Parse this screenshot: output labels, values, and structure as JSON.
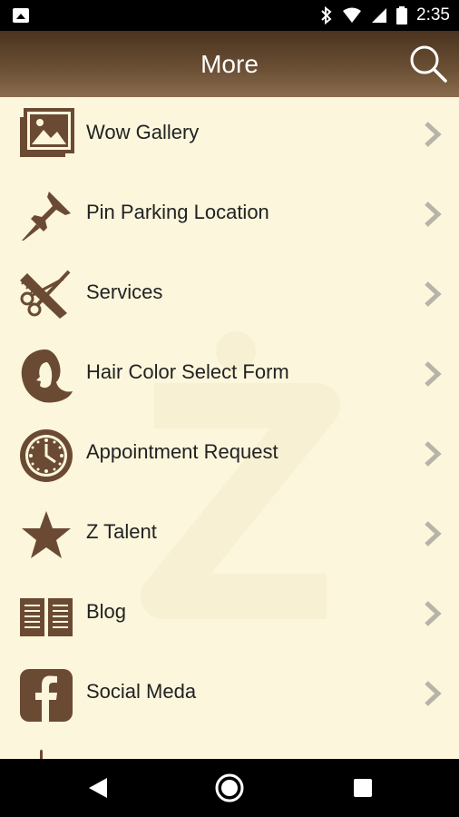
{
  "status_bar": {
    "time": "2:35"
  },
  "header": {
    "title": "More"
  },
  "menu": [
    {
      "label": "Wow Gallery",
      "icon": "gallery-icon"
    },
    {
      "label": "Pin Parking Location",
      "icon": "pushpin-icon"
    },
    {
      "label": "Services",
      "icon": "scissors-comb-icon"
    },
    {
      "label": "Hair Color Select Form",
      "icon": "woman-profile-icon"
    },
    {
      "label": "Appointment Request",
      "icon": "clock-icon"
    },
    {
      "label": "Z Talent",
      "icon": "star-icon"
    },
    {
      "label": "Blog",
      "icon": "open-book-icon"
    },
    {
      "label": "Social Meda",
      "icon": "facebook-icon"
    }
  ],
  "colors": {
    "header": "#5a3f29",
    "accent": "#6b4a33",
    "background": "#fbf6dc",
    "chevron": "#b8b3a8"
  }
}
